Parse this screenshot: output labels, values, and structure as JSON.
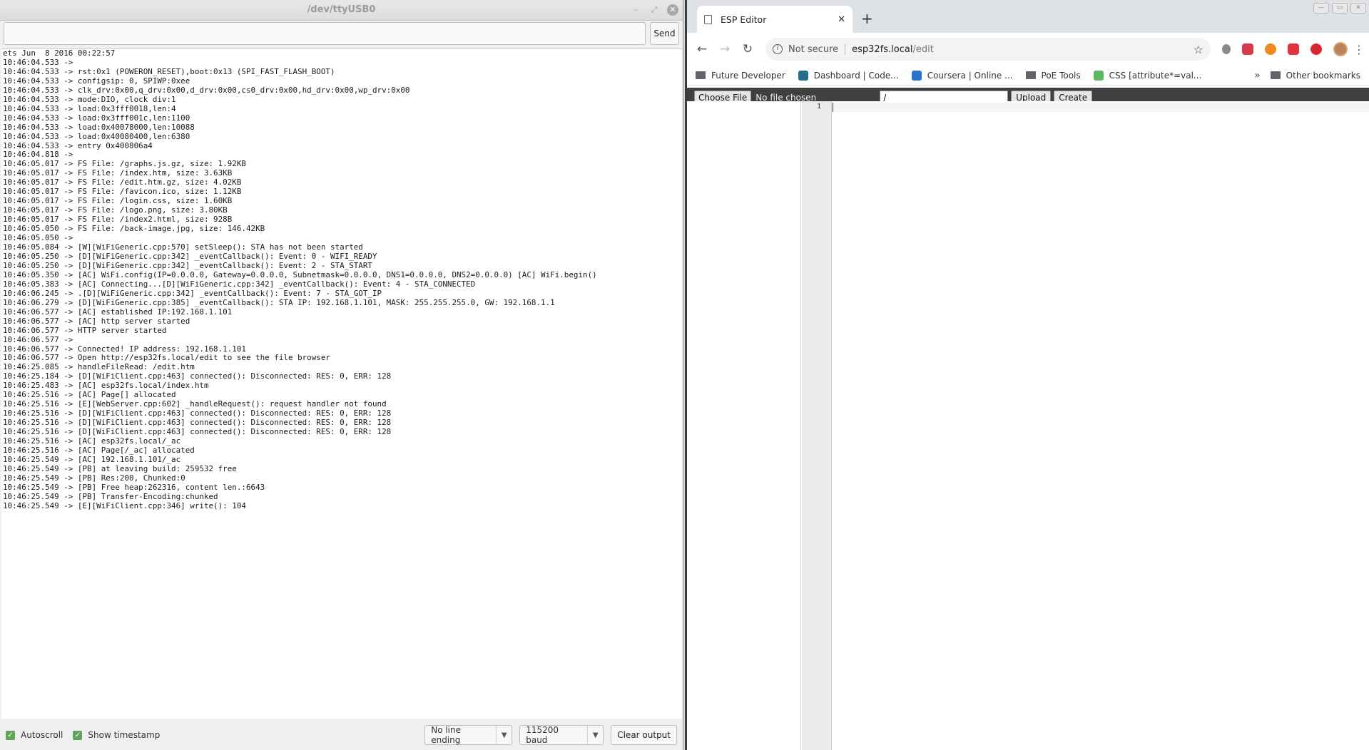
{
  "serial": {
    "title": "/dev/ttyUSB0",
    "send_label": "Send",
    "lines": [
      "ets Jun  8 2016 00:22:57",
      "10:46:04.533 -> ",
      "10:46:04.533 -> rst:0x1 (POWERON_RESET),boot:0x13 (SPI_FAST_FLASH_BOOT)",
      "10:46:04.533 -> configsip: 0, SPIWP:0xee",
      "10:46:04.533 -> clk_drv:0x00,q_drv:0x00,d_drv:0x00,cs0_drv:0x00,hd_drv:0x00,wp_drv:0x00",
      "10:46:04.533 -> mode:DIO, clock div:1",
      "10:46:04.533 -> load:0x3fff0018,len:4",
      "10:46:04.533 -> load:0x3fff001c,len:1100",
      "10:46:04.533 -> load:0x40078000,len:10088",
      "10:46:04.533 -> load:0x40080400,len:6380",
      "10:46:04.533 -> entry 0x400806a4",
      "10:46:04.818 -> ",
      "10:46:05.017 -> FS File: /graphs.js.gz, size: 1.92KB",
      "10:46:05.017 -> FS File: /index.htm, size: 3.63KB",
      "10:46:05.017 -> FS File: /edit.htm.gz, size: 4.02KB",
      "10:46:05.017 -> FS File: /favicon.ico, size: 1.12KB",
      "10:46:05.017 -> FS File: /login.css, size: 1.60KB",
      "10:46:05.017 -> FS File: /logo.png, size: 3.80KB",
      "10:46:05.017 -> FS File: /index2.html, size: 928B",
      "10:46:05.050 -> FS File: /back-image.jpg, size: 146.42KB",
      "10:46:05.050 -> ",
      "10:46:05.084 -> [W][WiFiGeneric.cpp:570] setSleep(): STA has not been started",
      "10:46:05.250 -> [D][WiFiGeneric.cpp:342] _eventCallback(): Event: 0 - WIFI_READY",
      "10:46:05.250 -> [D][WiFiGeneric.cpp:342] _eventCallback(): Event: 2 - STA_START",
      "10:46:05.350 -> [AC] WiFi.config(IP=0.0.0.0, Gateway=0.0.0.0, Subnetmask=0.0.0.0, DNS1=0.0.0.0, DNS2=0.0.0.0) [AC] WiFi.begin()",
      "10:46:05.383 -> [AC] Connecting...[D][WiFiGeneric.cpp:342] _eventCallback(): Event: 4 - STA_CONNECTED",
      "10:46:06.245 -> .[D][WiFiGeneric.cpp:342] _eventCallback(): Event: 7 - STA_GOT_IP",
      "10:46:06.279 -> [D][WiFiGeneric.cpp:385] _eventCallback(): STA IP: 192.168.1.101, MASK: 255.255.255.0, GW: 192.168.1.1",
      "10:46:06.577 -> [AC] established IP:192.168.1.101",
      "10:46:06.577 -> [AC] http server started",
      "10:46:06.577 -> HTTP server started",
      "10:46:06.577 -> ",
      "10:46:06.577 -> Connected! IP address: 192.168.1.101",
      "10:46:06.577 -> Open http://esp32fs.local/edit to see the file browser",
      "10:46:25.085 -> handleFileRead: /edit.htm",
      "10:46:25.184 -> [D][WiFiClient.cpp:463] connected(): Disconnected: RES: 0, ERR: 128",
      "10:46:25.483 -> [AC] esp32fs.local/index.htm",
      "10:46:25.516 -> [AC] Page[] allocated",
      "10:46:25.516 -> [E][WebServer.cpp:602] _handleRequest(): request handler not found",
      "10:46:25.516 -> [D][WiFiClient.cpp:463] connected(): Disconnected: RES: 0, ERR: 128",
      "10:46:25.516 -> [D][WiFiClient.cpp:463] connected(): Disconnected: RES: 0, ERR: 128",
      "10:46:25.516 -> [D][WiFiClient.cpp:463] connected(): Disconnected: RES: 0, ERR: 128",
      "10:46:25.516 -> [AC] esp32fs.local/_ac",
      "10:46:25.516 -> [AC] Page[/_ac] allocated",
      "10:46:25.549 -> [AC] 192.168.1.101/_ac",
      "10:46:25.549 -> [PB] at leaving build: 259532 free",
      "10:46:25.549 -> [PB] Res:200, Chunked:0",
      "10:46:25.549 -> [PB] Free heap:262316, content len.:6643",
      "10:46:25.549 -> [PB] Transfer-Encoding:chunked",
      "10:46:25.549 -> [E][WiFiClient.cpp:346] write(): 104"
    ],
    "footer": {
      "autoscroll_label": "Autoscroll",
      "timestamp_label": "Show timestamp",
      "line_ending": "No line ending",
      "baud": "115200 baud",
      "clear_label": "Clear output"
    }
  },
  "browser": {
    "tab_title": "ESP Editor",
    "not_secure": "Not secure",
    "url_host": "esp32fs.local",
    "url_path": "/edit",
    "bookmarks": [
      {
        "label": "Future Developer",
        "kind": "folder"
      },
      {
        "label": "Dashboard | Code...",
        "kind": "site",
        "color": "#1f6f8b"
      },
      {
        "label": "Coursera | Online ...",
        "kind": "site",
        "color": "#2a73cc"
      },
      {
        "label": "PoE Tools",
        "kind": "folder"
      },
      {
        "label": "CSS [attribute*=val...",
        "kind": "site",
        "color": "#5cb85c"
      }
    ],
    "other_bookmarks": "Other bookmarks",
    "editor": {
      "choose_file_label": "Choose File",
      "no_file_label": "No file chosen",
      "path_value": "/",
      "upload_label": "Upload",
      "create_label": "Create",
      "line_number": "1"
    }
  }
}
